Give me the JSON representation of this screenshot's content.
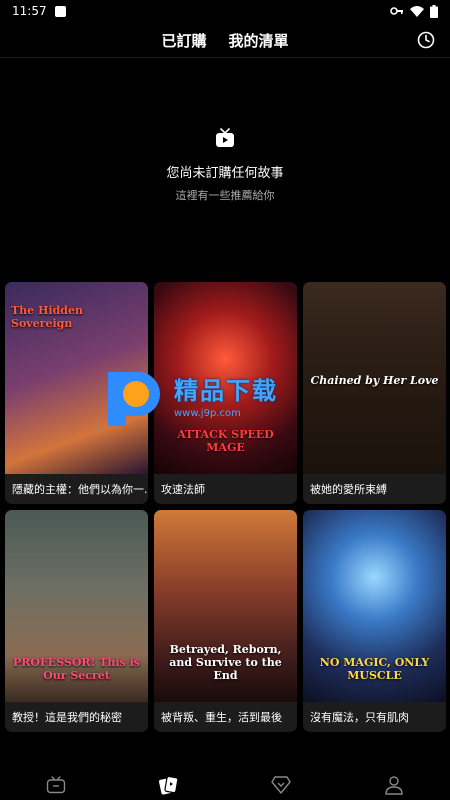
{
  "status": {
    "time": "11:57"
  },
  "header": {
    "tabs": [
      {
        "label": "已訂購"
      },
      {
        "label": "我的清單"
      }
    ]
  },
  "empty": {
    "title": "您尚未訂購任何故事",
    "subtitle": "這裡有一些推薦給你"
  },
  "watermark": {
    "text": "精品下载",
    "url": "www.j9p.com"
  },
  "cards": [
    {
      "title": "隱藏的主權：他們以為你一...",
      "cover_text": "The Hidden Sovereign"
    },
    {
      "title": "攻速法師",
      "cover_text": "ATTACK SPEED MAGE"
    },
    {
      "title": "被她的愛所束縛",
      "cover_text": "Chained by Her Love"
    },
    {
      "title": "教授！這是我們的秘密",
      "cover_text": "PROFESSOR! This is Our Secret"
    },
    {
      "title": "被背叛、重生，活到最後",
      "cover_text": "Betrayed, Reborn, and Survive to the End"
    },
    {
      "title": "沒有魔法，只有肌肉",
      "cover_text": "NO MAGIC, ONLY MUSCLE"
    }
  ],
  "colors": {
    "accent": "#3fa7ff",
    "background": "#000000",
    "card": "#1c1c1c"
  }
}
